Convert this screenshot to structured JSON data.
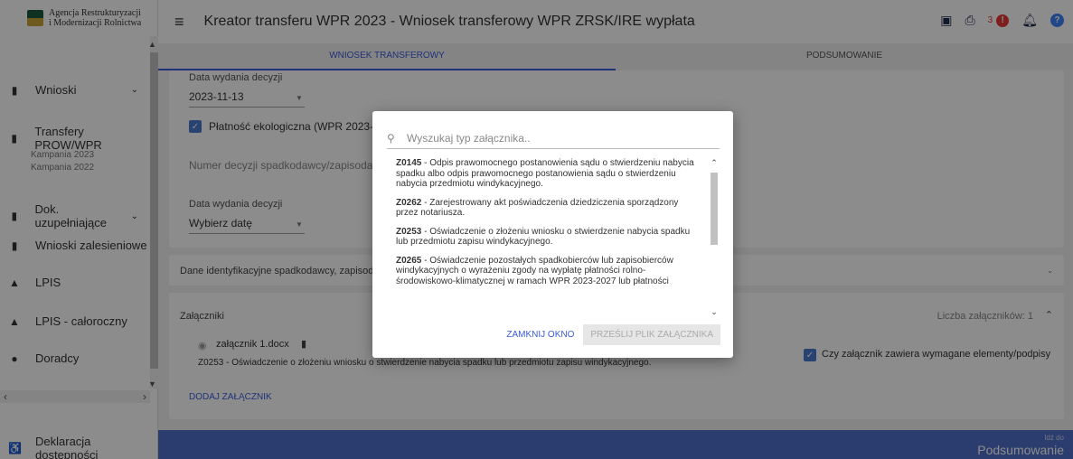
{
  "logo": {
    "line1": "Agencja Restrukturyzacji",
    "line2": "i Modernizacji Rolnictwa"
  },
  "sidebar": {
    "items": [
      {
        "label": "Wnioski",
        "icon": "document-icon",
        "chevron": true
      },
      {
        "label": "Transfery PROW/WPR",
        "icon": "document-icon",
        "chevron": false
      },
      {
        "label": "Dok. uzupełniające",
        "icon": "document-icon",
        "chevron": true
      },
      {
        "label": "Wnioski zalesieniowe",
        "icon": "document-icon",
        "chevron": false
      },
      {
        "label": "LPIS",
        "icon": "mountain-icon",
        "chevron": false
      },
      {
        "label": "LPIS - całoroczny",
        "icon": "mountain-icon",
        "chevron": false
      },
      {
        "label": "Doradcy",
        "icon": "person-icon",
        "chevron": false
      },
      {
        "label": "Deklaracja dostępności",
        "icon": "accessibility-icon",
        "chevron": false
      }
    ],
    "sub_items": [
      "Kampania 2023",
      "Kampania 2022"
    ]
  },
  "header": {
    "title": "Kreator transferu WPR 2023 - Wniosek transferowy WPR ZRSK/IRE wypłata",
    "error_count": "3"
  },
  "tabs": [
    {
      "label": "WNIOSEK TRANSFEROWY",
      "active": true
    },
    {
      "label": "PODSUMOWANIE",
      "active": false
    }
  ],
  "form": {
    "date_label_1": "Data wydania decyzji",
    "date_value_1": "2023-11-13",
    "eco_checkbox_label": "Płatność ekologiczna (WPR 2023-2027",
    "decision_number_placeholder": "Numer decyzji spadkodawcy/zapisodaw",
    "date_label_2": "Data wydania decyzji",
    "date_placeholder_2": "Wybierz datę",
    "heir_section_title": "Dane identyfikacyjne spadkodawcy, zapisodaw",
    "attachments_title": "Załączniki",
    "attachments_count": "Liczba załączników: 1",
    "attachment_filename": "załącznik 1.docx",
    "attachment_description": "Z0253 - Oświadczenie o złożeniu wniosku o stwierdzenie nabycia spadku lub przedmiotu zapisu windykacyjnego.",
    "required_elements_label": "Czy załącznik zawiera wymagane elementy/podpisy",
    "add_attachment_label": "DODAJ ZAŁĄCZNIK"
  },
  "footer": {
    "go_to_small": "Idź do",
    "go_to_big": "Podsumowanie"
  },
  "modal": {
    "search_placeholder": "Wyszukaj typ załącznika..",
    "items": [
      {
        "code": "Z0145",
        "text": " - Odpis prawomocnego postanowienia sądu o stwierdzeniu nabycia spadku albo odpis prawomocnego postanowienia sądu o stwierdzeniu nabycia przedmiotu windykacyjnego."
      },
      {
        "code": "Z0262",
        "text": " - Zarejestrowany akt poświadczenia dziedziczenia sporządzony przez notariusza."
      },
      {
        "code": "Z0253",
        "text": " - Oświadczenie o złożeniu wniosku o stwierdzenie nabycia spadku lub przedmiotu zapisu windykacyjnego."
      },
      {
        "code": "Z0265",
        "text": " - Oświadczenie pozostałych spadkobierców lub zapisobierców windykacyjnych o wyrażeniu zgody na wypłatę płatności rolno-środowiskowo-klimatycznej w ramach WPR 2023-2027 lub płatności"
      }
    ],
    "close_label": "ZAMKNIJ OKNO",
    "send_label": "PRZEŚLIJ PLIK ZAŁĄCZNIKA"
  }
}
